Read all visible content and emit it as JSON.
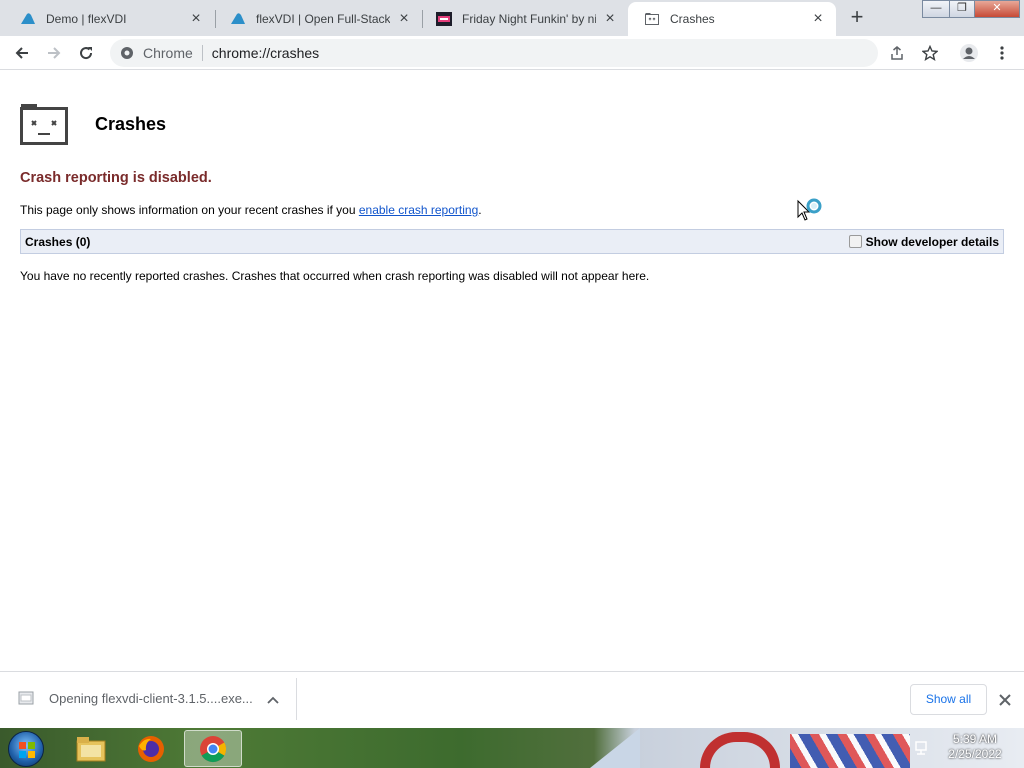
{
  "tabs": [
    {
      "title": "Demo | flexVDI",
      "icon": "flexvdi-cloud-icon",
      "active": false
    },
    {
      "title": "flexVDI | Open Full-Stack V",
      "icon": "flexvdi-cloud-icon",
      "active": false
    },
    {
      "title": "Friday Night Funkin' by nin",
      "icon": "fnf-logo-icon",
      "active": false
    },
    {
      "title": "Crashes",
      "icon": "crash-page-icon",
      "active": true
    }
  ],
  "new_tab_label": "+",
  "window_controls": {
    "minimize": "—",
    "restore": "❐"
  },
  "omnibox": {
    "site_chip": "Chrome",
    "url": "chrome://crashes"
  },
  "page": {
    "title": "Crashes",
    "status": "Crash reporting is disabled.",
    "info_prefix": "This page only shows information on your recent crashes if you ",
    "info_link": "enable crash reporting",
    "info_suffix": ".",
    "crash_count_label": "Crashes (0)",
    "dev_details_label": "Show developer details",
    "empty_message": "You have no recently reported crashes. Crashes that occurred when crash reporting was disabled will not appear here."
  },
  "download_shelf": {
    "item_label": "Opening flexvdi-client-3.1.5....exe...",
    "show_all_label": "Show all"
  },
  "taskbar": {
    "time": "5:39 AM",
    "date": "2/25/2022",
    "pinned": [
      "explorer-icon",
      "firefox-icon",
      "chrome-icon"
    ]
  },
  "colors": {
    "status_text": "#7a2b2b",
    "link": "#1155cc",
    "crash_bar_bg": "#eaeef6",
    "show_all_text": "#1a73e8"
  }
}
